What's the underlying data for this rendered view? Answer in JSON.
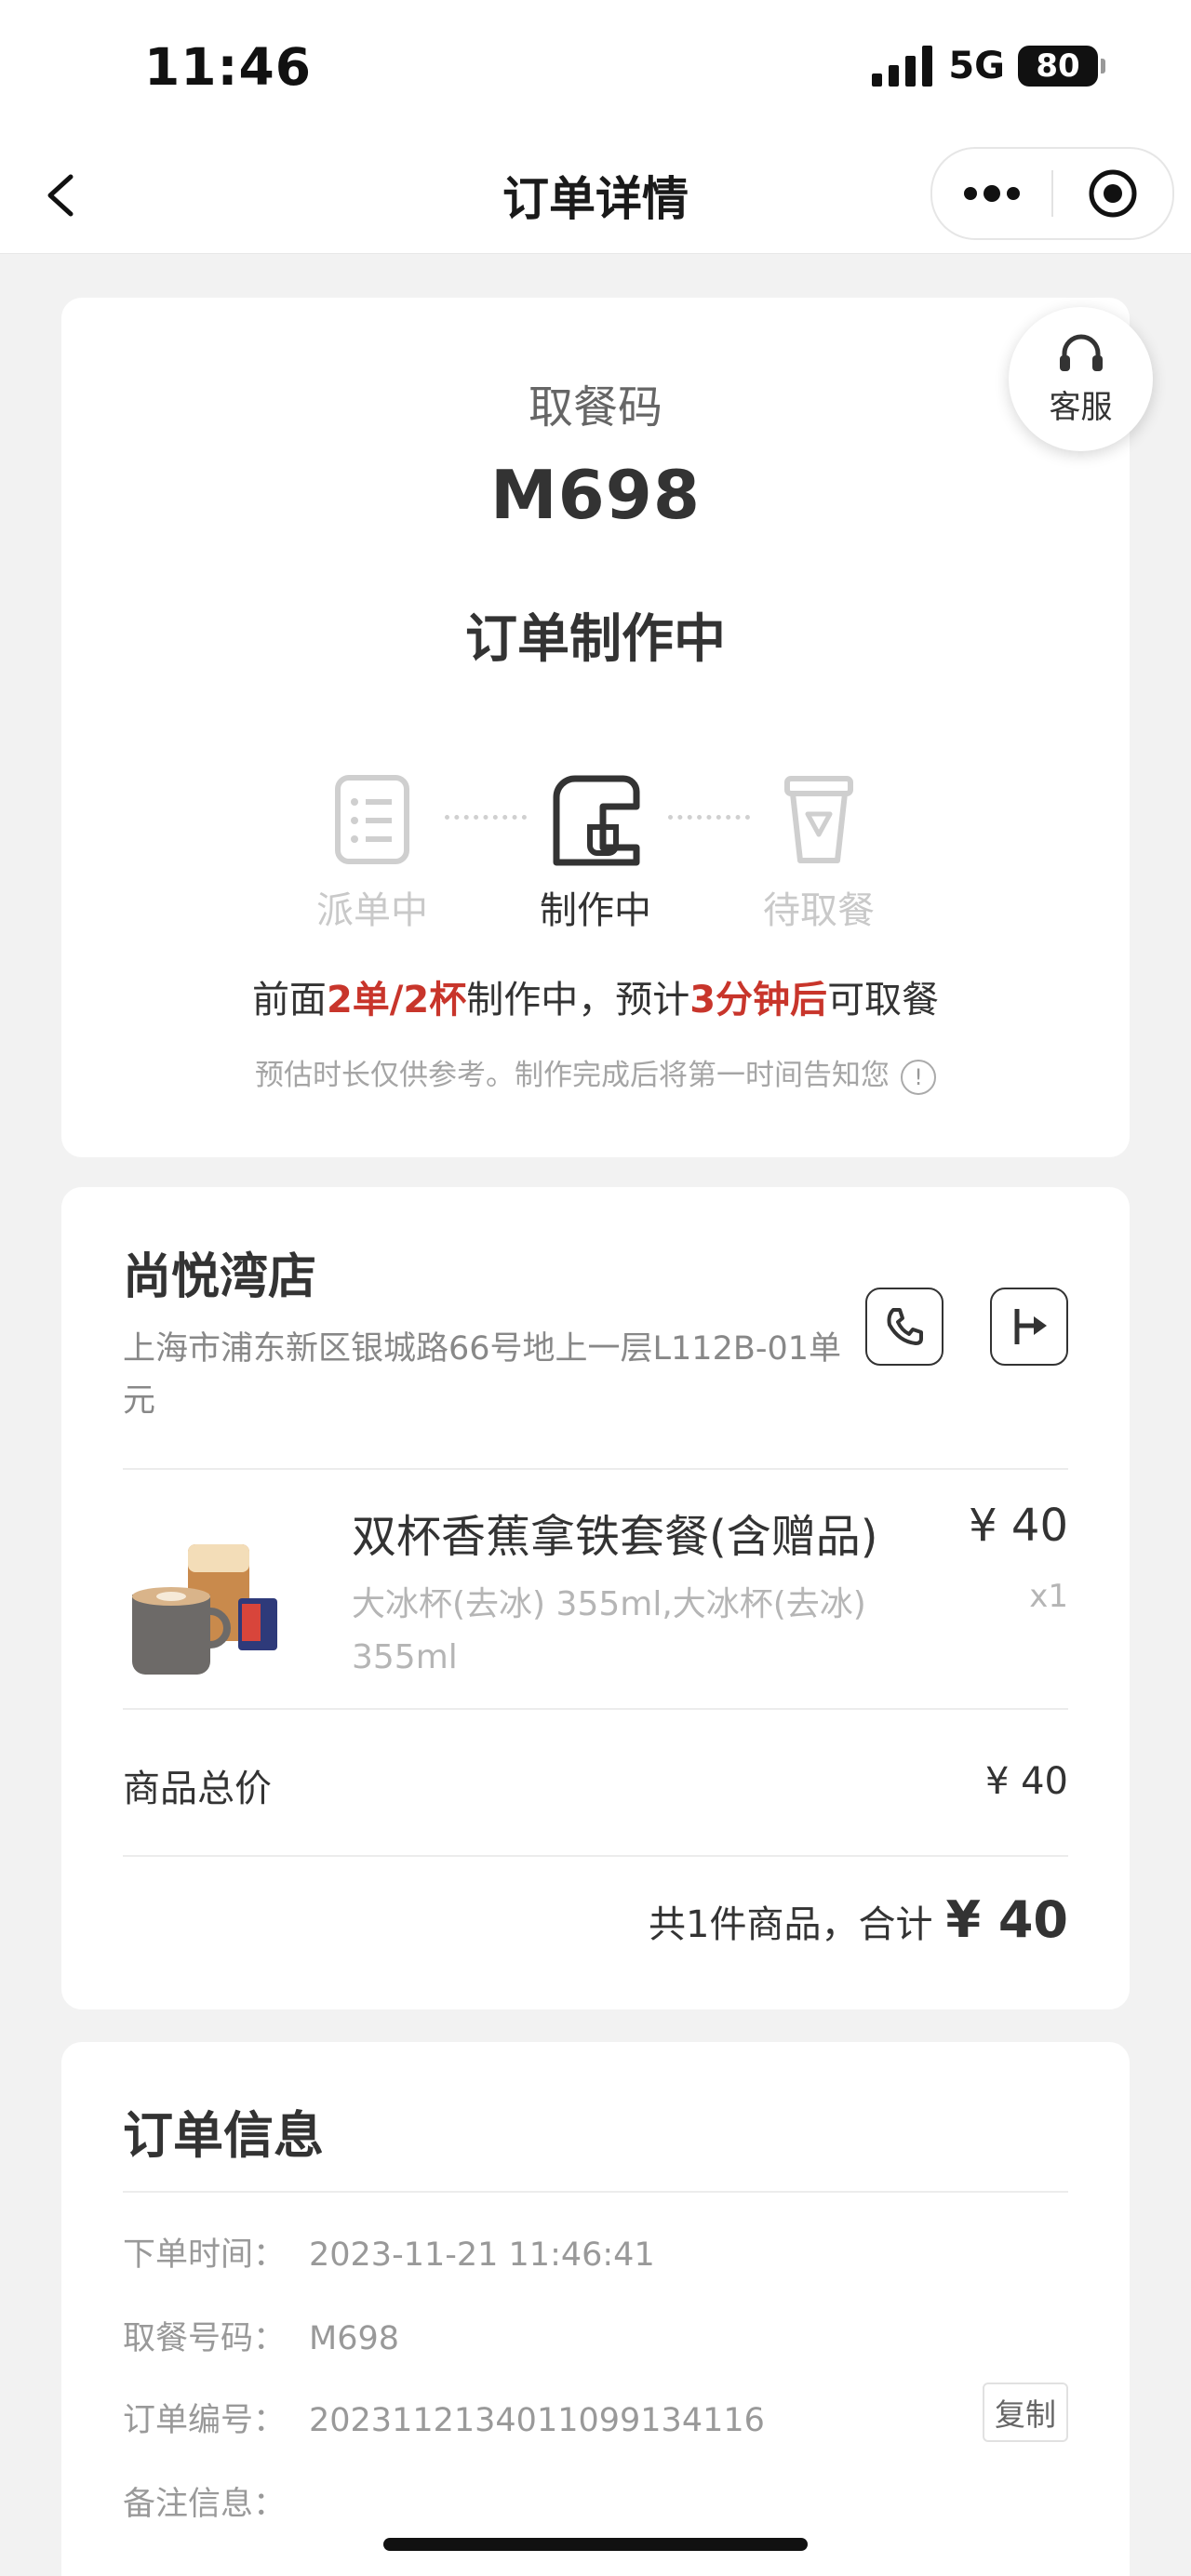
{
  "status_bar": {
    "time": "11:46",
    "network": "5G",
    "battery": "80"
  },
  "nav": {
    "title": "订单详情"
  },
  "service": {
    "label": "客服"
  },
  "pickup": {
    "label": "取餐码",
    "code": "M698",
    "status": "订单制作中",
    "steps": [
      "派单中",
      "制作中",
      "待取餐"
    ],
    "queue": {
      "prefix": "前面",
      "orders": "2单/2杯",
      "middle": "制作中，预计",
      "eta": "3分钟后",
      "suffix": "可取餐"
    },
    "note": "预估时长仅供参考。制作完成后将第一时间告知您",
    "info_glyph": "!"
  },
  "store": {
    "name": "尚悦湾店",
    "address": "上海市浦东新区银城路66号地上一层L112B-01单元"
  },
  "product": {
    "name": "双杯香蕉拿铁套餐(含赠品)",
    "price": "¥ 40",
    "spec": "大冰杯(去冰) 355ml,大冰杯(去冰) 355ml",
    "qty": "x1"
  },
  "totals": {
    "label": "商品总价",
    "value": "¥ 40",
    "summary_text": "共1件商品，合计",
    "summary_amount": "¥ 40"
  },
  "order_info": {
    "title": "订单信息",
    "rows": [
      {
        "key": "下单时间：",
        "value": "2023-11-21 11:46:41"
      },
      {
        "key": "取餐号码：",
        "value": "M698"
      },
      {
        "key": "订单编号：",
        "value": "2023112134011099134116"
      },
      {
        "key": "备注信息：",
        "value": ""
      }
    ],
    "copy_label": "复制"
  },
  "colors": {
    "accent_red": "#c8352b",
    "page_bg": "#f2f2f2"
  }
}
